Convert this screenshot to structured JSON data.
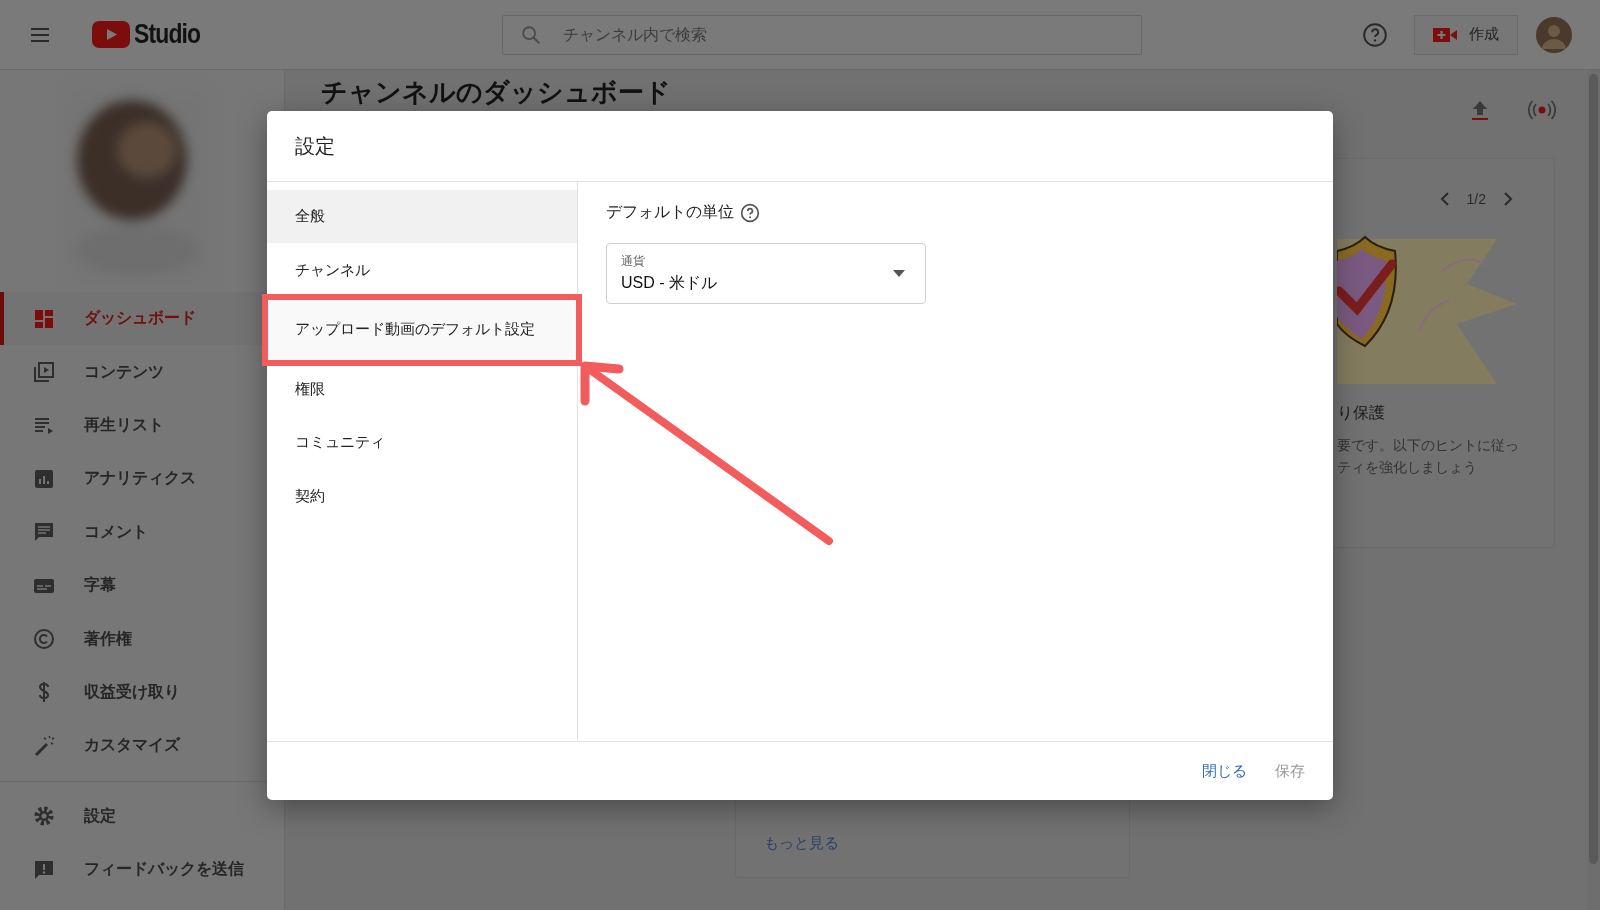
{
  "header": {
    "logo": "Studio",
    "search": {
      "placeholder": "チャンネル内で検索"
    },
    "create_button": "作成"
  },
  "sidebar": {
    "items": [
      {
        "label": "ダッシュボード",
        "selected": true
      },
      {
        "label": "コンテンツ",
        "selected": false
      },
      {
        "label": "再生リスト",
        "selected": false
      },
      {
        "label": "アナリティクス",
        "selected": false
      },
      {
        "label": "コメント",
        "selected": false
      },
      {
        "label": "字幕",
        "selected": false
      },
      {
        "label": "著作権",
        "selected": false
      },
      {
        "label": "収益受け取り",
        "selected": false
      },
      {
        "label": "カスタマイズ",
        "selected": false
      }
    ],
    "footer_items": [
      {
        "label": "設定",
        "selected": false
      },
      {
        "label": "フィードバックを送信",
        "selected": false
      }
    ]
  },
  "page": {
    "title": "チャンネルのダッシュボード",
    "tip_card": {
      "pager": "1/2",
      "title": "り保護",
      "body": [
        "要です。以下のヒントに従っ",
        "ティを強化しましょう"
      ]
    },
    "news_card": {
      "link": "もっと見る"
    }
  },
  "dialog": {
    "title": "設定",
    "tabs": [
      {
        "label": "全般",
        "selected": true,
        "highlighted": false
      },
      {
        "label": "チャンネル",
        "selected": false,
        "highlighted": false
      },
      {
        "label": "アップロード動画のデフォルト設定",
        "selected": false,
        "highlighted": true
      },
      {
        "label": "権限",
        "selected": false,
        "highlighted": false
      },
      {
        "label": "コミュニティ",
        "selected": false,
        "highlighted": false
      },
      {
        "label": "契約",
        "selected": false,
        "highlighted": false
      }
    ],
    "section_title": "デフォルトの単位",
    "select": {
      "label": "通貨",
      "value": "USD - 米ドル"
    },
    "buttons": [
      {
        "label": "閉じる",
        "kind": "primary"
      },
      {
        "label": "保存",
        "kind": "disabled"
      }
    ]
  }
}
